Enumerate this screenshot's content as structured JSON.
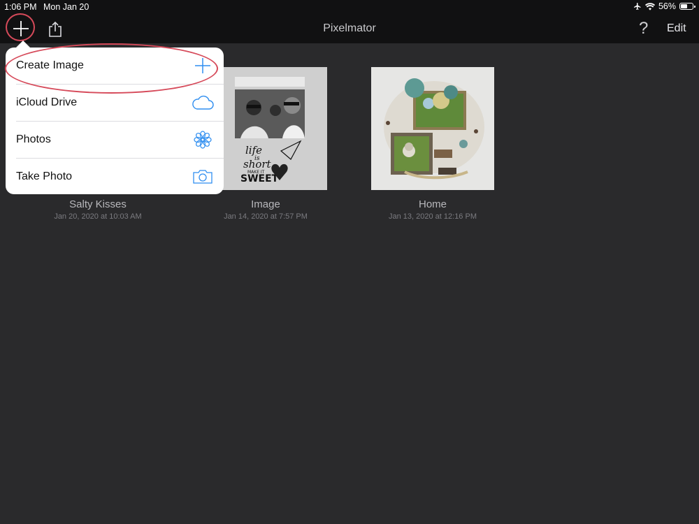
{
  "status_bar": {
    "time": "1:06 PM",
    "date": "Mon Jan 20",
    "battery": "56%",
    "battery_level": 0.56,
    "icons": [
      "airplane-icon",
      "wifi-icon",
      "battery-icon"
    ]
  },
  "nav": {
    "title": "Pixelmator",
    "help_label": "?",
    "edit_label": "Edit",
    "icons": [
      "plus-icon",
      "share-icon"
    ]
  },
  "documents": [
    {
      "name": "Salty Kisses",
      "date": "Jan 20, 2020 at 10:03 AM"
    },
    {
      "name": "Image",
      "date": "Jan 14, 2020 at 7:57 PM"
    },
    {
      "name": "Home",
      "date": "Jan 13, 2020 at 12:16 PM"
    }
  ],
  "thumbnail_texts": {
    "life": "life",
    "is": "is",
    "short": "short",
    "make_it": "MAKE IT",
    "sweet": "SWEET"
  },
  "popover": {
    "items": [
      {
        "label": "Create Image",
        "icon": "plus-icon"
      },
      {
        "label": "iCloud Drive",
        "icon": "cloud-icon"
      },
      {
        "label": "Photos",
        "icon": "photos-flower-icon"
      },
      {
        "label": "Take Photo",
        "icon": "camera-icon"
      }
    ]
  },
  "colors": {
    "accent": "#2f8ef0",
    "annotation": "#d64a5a",
    "background": "#2a2a2c",
    "bar": "#111112"
  }
}
